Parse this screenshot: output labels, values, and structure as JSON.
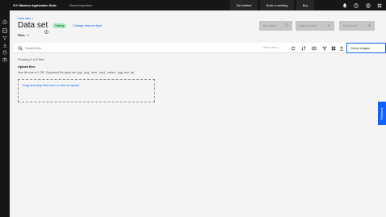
{
  "header": {
    "brand_ibm": "IBM",
    "brand_name": "Maximo Application Suite",
    "product": "Visual Inspection",
    "get_started": "Get started",
    "book_meeting": "Book a meeting",
    "buy": "Buy",
    "icons": [
      "notification-icon",
      "help-icon",
      "user-icon",
      "app-switcher-icon"
    ]
  },
  "rail": {
    "icons": [
      "home-icon",
      "dataset-icon",
      "model-icon",
      "deploy-icon",
      "data-icon",
      "camera-icon"
    ]
  },
  "page": {
    "breadcrumb": "Data sets",
    "breadcrumb_sep": "/",
    "title": "Data set",
    "status_tag": "Training",
    "change_link": "Change data set type",
    "files_label": "Files",
    "files_count": "0"
  },
  "actions": {
    "auto_label": "Auto label",
    "augment": "Augment data",
    "train": "Train model"
  },
  "toolbar": {
    "search_placeholder": "Search files",
    "select_files": "Select files",
    "group_images": "Group images"
  },
  "content": {
    "showing": "Showing 0 of 0 files",
    "upload_title": "Upload files",
    "upload_desc": "Max file size is 2 GB. Supported file types are .jpg, .png, .dcm, .mp4, .webm, .ogg, and .zip.",
    "dropzone": "Drag and drop files here or click to upload"
  },
  "feedback": "Feedback",
  "colors": {
    "header_bg": "#161616",
    "page_bg": "#f4f4f4",
    "link": "#0f62fe",
    "tag_bg": "#a7f0ba",
    "disabled_btn": "#c6c6c6"
  }
}
